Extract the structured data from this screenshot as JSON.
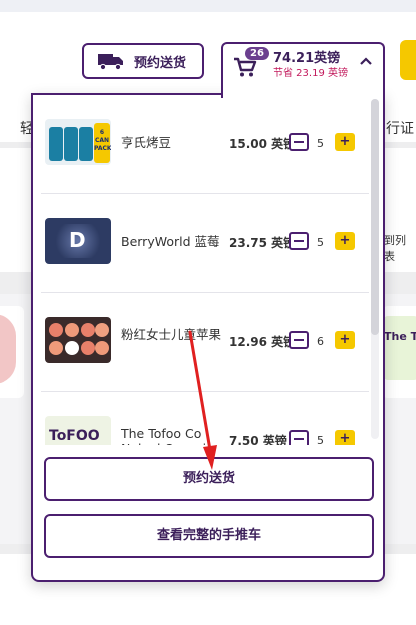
{
  "header": {
    "delivery_button": "预约送货",
    "cart": {
      "badge": "26",
      "total": "74.21英镑",
      "savings": "节省 23.19 英镑"
    }
  },
  "background": {
    "left_nav_fragment": "轻",
    "right_nav_fragment": "行证",
    "right_link_fragment": "到列表",
    "card_brand_fragment": "The TOFOO"
  },
  "cart_panel": {
    "items": [
      {
        "name": "亨氏烤豆",
        "price": "15.00 英镑",
        "qty": "5",
        "plus": "+",
        "thumb_label": "6 CAN PACK"
      },
      {
        "name": "BerryWorld 蓝莓",
        "price": "23.75 英镑",
        "qty": "5",
        "plus": "+",
        "thumb_label": "D"
      },
      {
        "name": "粉红女士儿童苹果",
        "price": "12.96 英镑",
        "qty": "6",
        "plus": "+",
        "thumb_label": ""
      },
      {
        "name": "The Tofoo Co Naked Organic 无",
        "price": "7.50 英镑",
        "qty": "5",
        "plus": "+",
        "thumb_label": "ToFOO"
      }
    ],
    "checkout_button": "预约送货",
    "view_cart_button": "查看完整的手推车"
  },
  "colors": {
    "brand_purple": "#4b1f6f",
    "accent_yellow": "#f5c800",
    "savings_red": "#c2185b",
    "arrow_red": "#e02020"
  }
}
